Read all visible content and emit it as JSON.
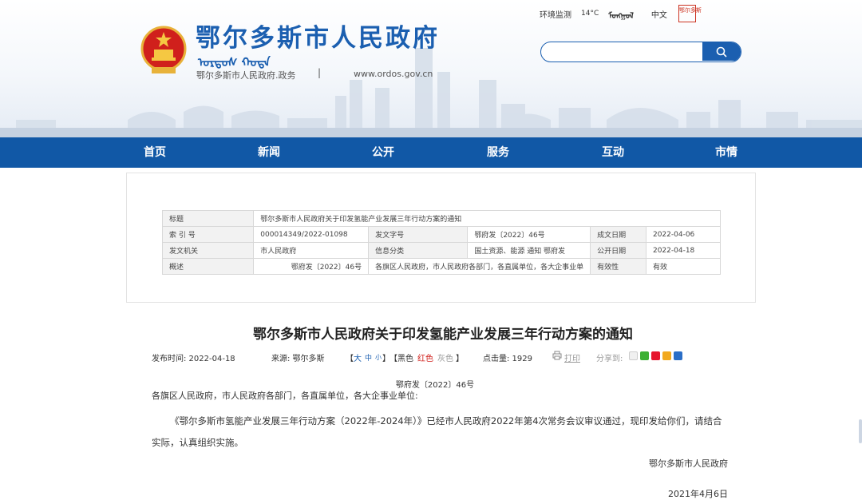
{
  "header": {
    "site_title": "鄂尔多斯市人民政府",
    "mongolian_title": "ᠣᠷᠳᠣᠰ ᠬᠣᠲᠠ",
    "subtitle_left": "鄂尔多斯市人民政府.政务",
    "subtitle_sep": "|",
    "subtitle_right": "www.ordos.gov.cn",
    "top_links": {
      "env_monitor": "环境监测",
      "temperature": "14°C",
      "mongolian": "ᠮᠣᠩᠭᠣᠯ",
      "chinese": "中文",
      "seal_text": "鄂尔多斯"
    },
    "search": {
      "placeholder": ""
    }
  },
  "nav": {
    "items": [
      {
        "label": "首页"
      },
      {
        "label": "新闻"
      },
      {
        "label": "公开"
      },
      {
        "label": "服务"
      },
      {
        "label": "互动"
      },
      {
        "label": "市情"
      }
    ]
  },
  "info_table": {
    "row1": {
      "label": "标题",
      "value": "鄂尔多斯市人民政府关于印发氢能产业发展三年行动方案的通知"
    },
    "row2": {
      "label1": "索 引 号",
      "value1": "000014349/2022-01098",
      "label2": "发文字号",
      "value2": "鄂府发〔2022〕46号",
      "label3": "成文日期",
      "value3": "2022-04-06"
    },
    "row3": {
      "label1": "发文机关",
      "value1": "市人民政府",
      "label2": "信息分类",
      "value2": "国土资源、能源  通知  鄂府发",
      "label3": "公开日期",
      "value3": "2022-04-18"
    },
    "row4": {
      "label1": "概述",
      "value1": "鄂府发〔2022〕46号",
      "value2": "各旗区人民政府，市人民政府各部门，各直属单位，各大企事业单",
      "label3": "有效性",
      "value3": "有效"
    }
  },
  "article": {
    "title": "鄂尔多斯市人民政府关于印发氢能产业发展三年行动方案的通知",
    "meta": {
      "publish_time": "发布时间:  2022-04-18",
      "source": "来源:  鄂尔多斯",
      "size_open": "【",
      "size_large": "大",
      "size_medium": "中",
      "size_small": "小",
      "size_close": "】",
      "color_open": "【",
      "color_black": "黑色",
      "color_red": "红色",
      "color_gray": "灰色",
      "color_close": "】",
      "hits": "点击量:  1929",
      "print": "打印",
      "share": "分享到:"
    },
    "doc_number": "鄂府发〔2022〕46号",
    "recipients": "各旗区人民政府，市人民政府各部门，各直属单位，各大企事业单位:",
    "body": "《鄂尔多斯市氢能产业发展三年行动方案（2022年-2024年）》已经市人民政府2022年第4次常务会议审议通过，现印发给你们，请结合实际，认真组织实施。",
    "signature": "鄂尔多斯市人民政府",
    "sign_date": "2021年4月6日"
  },
  "colors": {
    "brand_blue": "#1b5fb0",
    "nav_blue": "#1158a6",
    "accent_red": "#d0201c"
  }
}
